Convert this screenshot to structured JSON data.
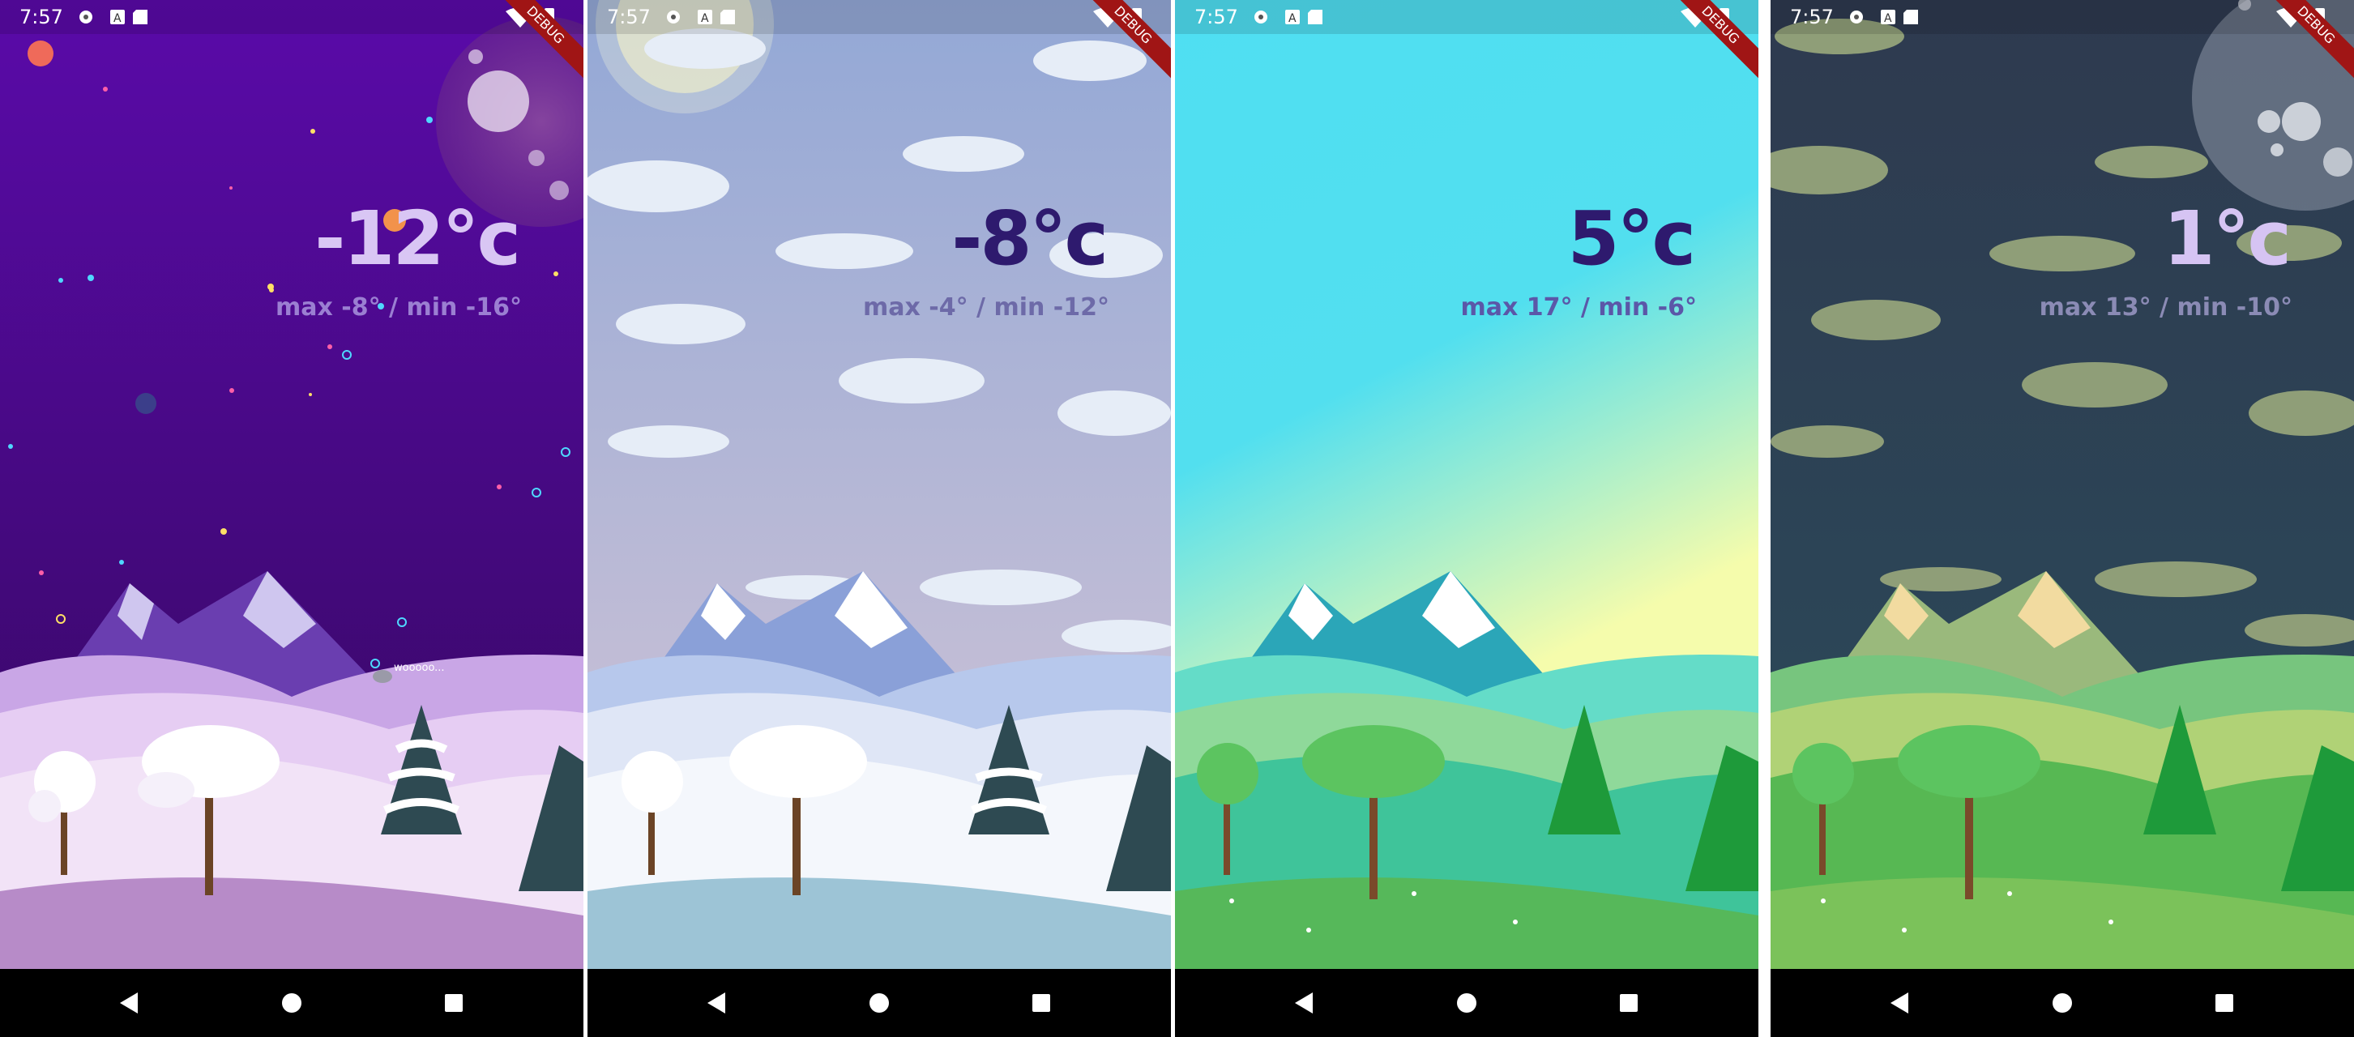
{
  "status_bar": {
    "time": "7:57",
    "left_icons": [
      "settings-icon",
      "a-notification-icon",
      "sd-card-icon"
    ],
    "right_icons": [
      "wifi-icon",
      "battery-icon"
    ],
    "debug_label": "DEBUG"
  },
  "screens": [
    {
      "theme": "winter-night",
      "temperature": "-12°c",
      "range": "max -8° / min -16°",
      "sky_easter_egg_label": "wooooo...",
      "colors": {
        "sky_top": "#5a0aa9",
        "sky_bottom": "#3a0a6e",
        "temperature": "#d9c6f4",
        "range": "#9b7fd2"
      }
    },
    {
      "theme": "winter-day",
      "temperature": "-8°c",
      "range": "max -4° / min -12°",
      "colors": {
        "sky_top": "#9fb0d7",
        "sky_bottom": "#ccc3d6",
        "temperature": "#2e1a6e",
        "range": "#6d6aa8"
      }
    },
    {
      "theme": "summer-day",
      "temperature": "5°c",
      "range": "max 17° / min -6°",
      "colors": {
        "sky_top": "#4fdff2",
        "sky_bottom": "#f6fcaa",
        "temperature": "#2e1a6e",
        "range": "#5b57a8"
      }
    },
    {
      "theme": "summer-night",
      "temperature": "1°c",
      "range": "max 13° / min -10°",
      "colors": {
        "sky_top": "#2f3a4e",
        "sky_bottom": "#2c4a5a",
        "temperature": "#d6c4f3",
        "range": "#8b8bb5"
      }
    }
  ],
  "navigation_bar": {
    "buttons": [
      "back-icon",
      "home-icon",
      "recents-icon"
    ]
  }
}
